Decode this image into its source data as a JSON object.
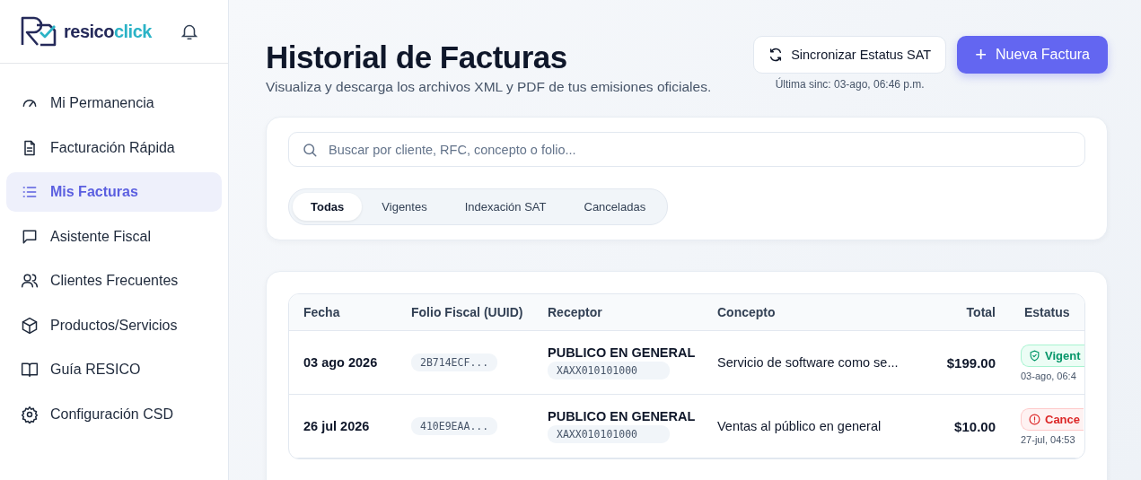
{
  "brand": {
    "name_dark": "resico",
    "name_accent": "click"
  },
  "sidebar": {
    "items": [
      {
        "label": "Mi Permanencia",
        "selected": false
      },
      {
        "label": "Facturación Rápida",
        "selected": false
      },
      {
        "label": "Mis Facturas",
        "selected": true
      },
      {
        "label": "Asistente Fiscal",
        "selected": false
      },
      {
        "label": "Clientes Frecuentes",
        "selected": false
      },
      {
        "label": "Productos/Servicios",
        "selected": false
      },
      {
        "label": "Guía RESICO",
        "selected": false
      },
      {
        "label": "Configuración CSD",
        "selected": false
      }
    ]
  },
  "header": {
    "title": "Historial de Facturas",
    "subtitle": "Visualiza y descarga los archivos XML y PDF de tus emisiones oficiales.",
    "sync_button": "Sincronizar Estatus SAT",
    "last_sync": "Última sinc: 03-ago, 06:46 p.m.",
    "new_button": "Nueva Factura",
    "new_icon": "+"
  },
  "search": {
    "placeholder": "Buscar por cliente, RFC, concepto o folio..."
  },
  "filters": [
    {
      "label": "Todas",
      "selected": true
    },
    {
      "label": "Vigentes",
      "selected": false
    },
    {
      "label": "Indexación SAT",
      "selected": false
    },
    {
      "label": "Canceladas",
      "selected": false
    }
  ],
  "table": {
    "columns": [
      "Fecha",
      "Folio Fiscal (UUID)",
      "Receptor",
      "Concepto",
      "Total",
      "Estatus"
    ],
    "rows": [
      {
        "date": "03 ago 2026",
        "uuid": "2B714ECF...",
        "receiver": "PUBLICO EN GENERAL",
        "rfc": "XAXX010101000",
        "concept": "Servicio de software como se...",
        "total": "$199.00",
        "status": {
          "kind": "valid",
          "label": "Vigent",
          "time": "03-ago, 06:4"
        }
      },
      {
        "date": "26 jul 2026",
        "uuid": "410E9EAA...",
        "receiver": "PUBLICO EN GENERAL",
        "rfc": "XAXX010101000",
        "concept": "Ventas al público en general",
        "total": "$10.00",
        "status": {
          "kind": "cancelled",
          "label": "Cance",
          "time": "27-jul, 04:53"
        }
      }
    ]
  }
}
